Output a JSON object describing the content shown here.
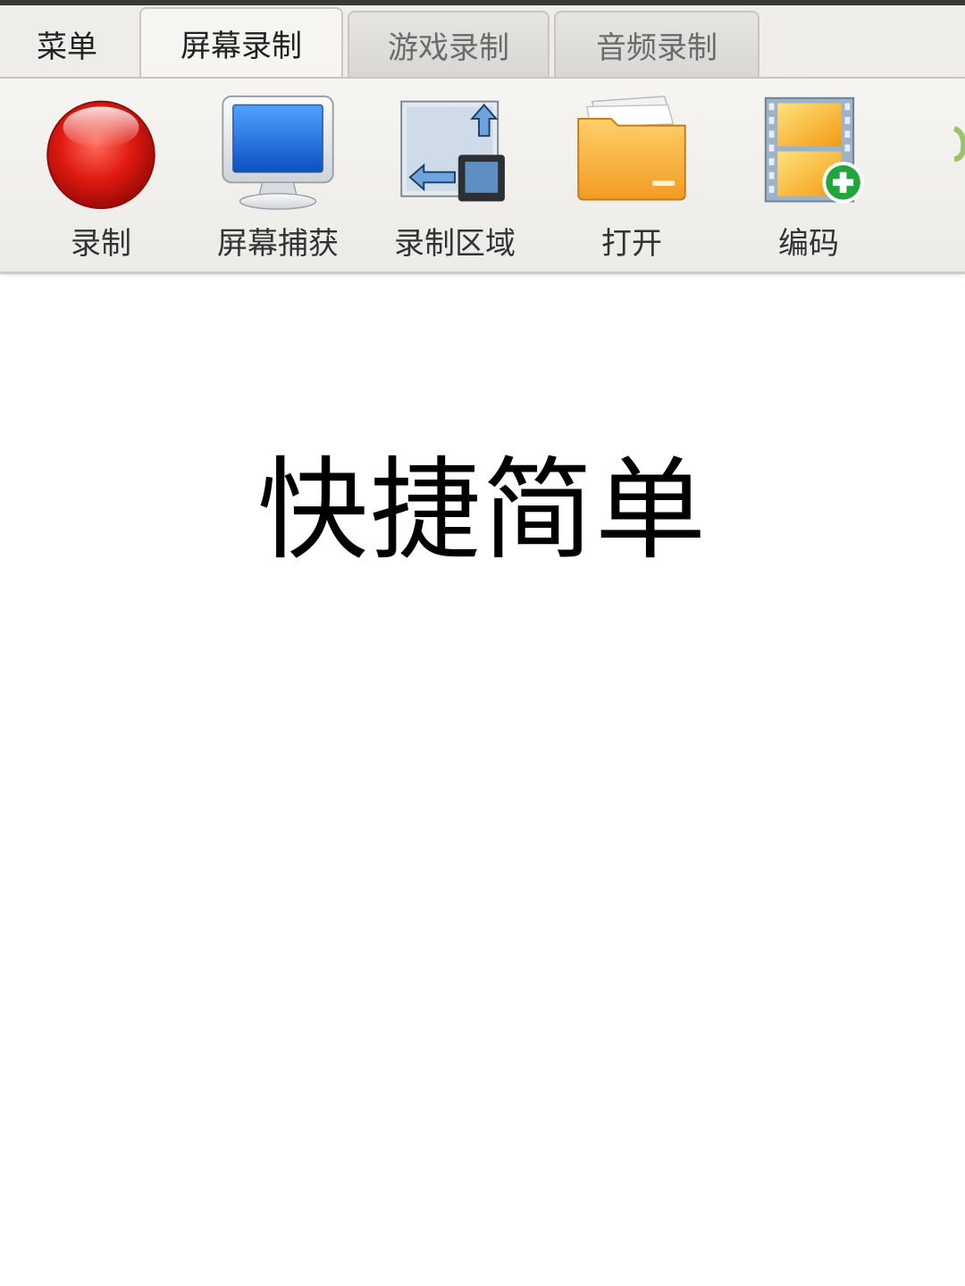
{
  "tabs": {
    "menu": "菜单",
    "screen_record": "屏幕录制",
    "game_record": "游戏录制",
    "audio_record": "音频录制",
    "active": "屏幕录制"
  },
  "toolbar": {
    "items": [
      {
        "label": "录制",
        "icon": "record-icon"
      },
      {
        "label": "屏幕捕获",
        "icon": "monitor-icon"
      },
      {
        "label": "录制区域",
        "icon": "region-icon"
      },
      {
        "label": "打开",
        "icon": "folder-icon"
      },
      {
        "label": "编码",
        "icon": "film-add-icon"
      }
    ]
  },
  "headline": "快捷简单",
  "colors": {
    "record_red": "#d8160f",
    "monitor_blue": "#1f6fd6",
    "folder_orange": "#f4a531",
    "add_green": "#22a53a"
  }
}
